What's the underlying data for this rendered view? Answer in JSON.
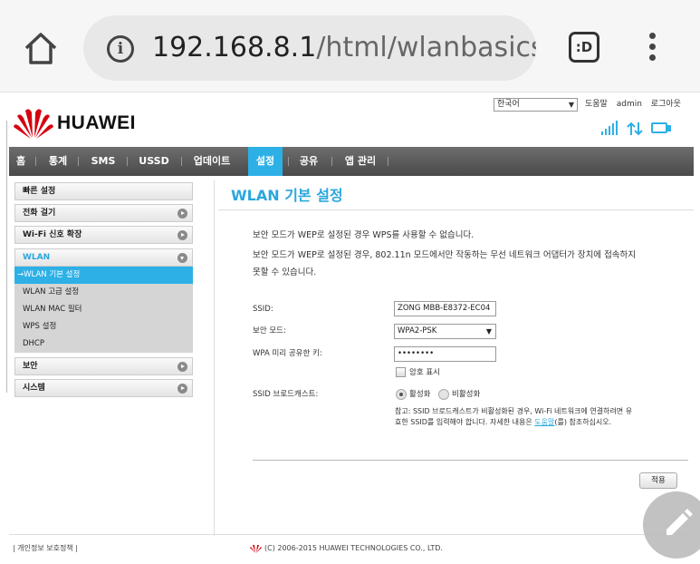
{
  "browser": {
    "url_main": "192.168.8.1",
    "url_rest": "/html/wlanbasicse",
    "tabs_label": ":D"
  },
  "header": {
    "brand": "HUAWEI",
    "language": "한국어",
    "links": [
      "도움말",
      "admin",
      "로그아웃"
    ]
  },
  "nav": {
    "items": [
      "홈",
      "통계",
      "SMS",
      "USSD",
      "업데이트",
      "설정",
      "공유",
      "앱 관리"
    ],
    "active": "설정"
  },
  "sidebar": {
    "items": [
      "빠른 설정",
      "전화 걸기",
      "Wi-Fi 신호 확장",
      "WLAN",
      "보안",
      "시스템"
    ],
    "wlan_sub": [
      "→WLAN 기본 설정",
      "WLAN 고급 설정",
      "WLAN MAC 필터",
      "WPS 설정",
      "DHCP"
    ]
  },
  "main": {
    "title": "WLAN 기본 설정",
    "notes": [
      "보안 모드가 WEP로 설정된 경우 WPS를 사용할 수 없습니다.",
      "보안 모드가 WEP로 설정된 경우, 802.11n 모드에서만 작동하는 무선 네트워크 어댑터가 장치에 접속하지",
      "못할 수 있습니다."
    ],
    "ssid_label": "SSID:",
    "ssid_value": "ZONG MBB-E8372-EC04",
    "security_label": "보안 모드:",
    "security_value": "WPA2-PSK",
    "psk_label": "WPA 미리 공유한 키:",
    "psk_value": "••••••••",
    "show_password": "암호 표시",
    "broadcast_label": "SSID 브로드캐스트:",
    "broadcast_on": "활성화",
    "broadcast_off": "비활성화",
    "hint_line1": "참고: SSID 브로드캐스트가 비활성화된 경우, Wi-Fi 네트워크에 연결하려면 유",
    "hint_line2a": "효한 SSID를 입력해야 합니다. 자세한 내용은 ",
    "hint_link": "도움말",
    "hint_line2b": "(를) 참조하십시오.",
    "apply": "적용"
  },
  "footer": {
    "privacy": "개인정보 보호정책",
    "copyright": "(C) 2006-2015 HUAWEI TECHNOLOGIES CO., LTD."
  },
  "colors": {
    "accent": "#2db0e6",
    "nav_bg": "#595959",
    "huawei_red": "#d7000f"
  }
}
